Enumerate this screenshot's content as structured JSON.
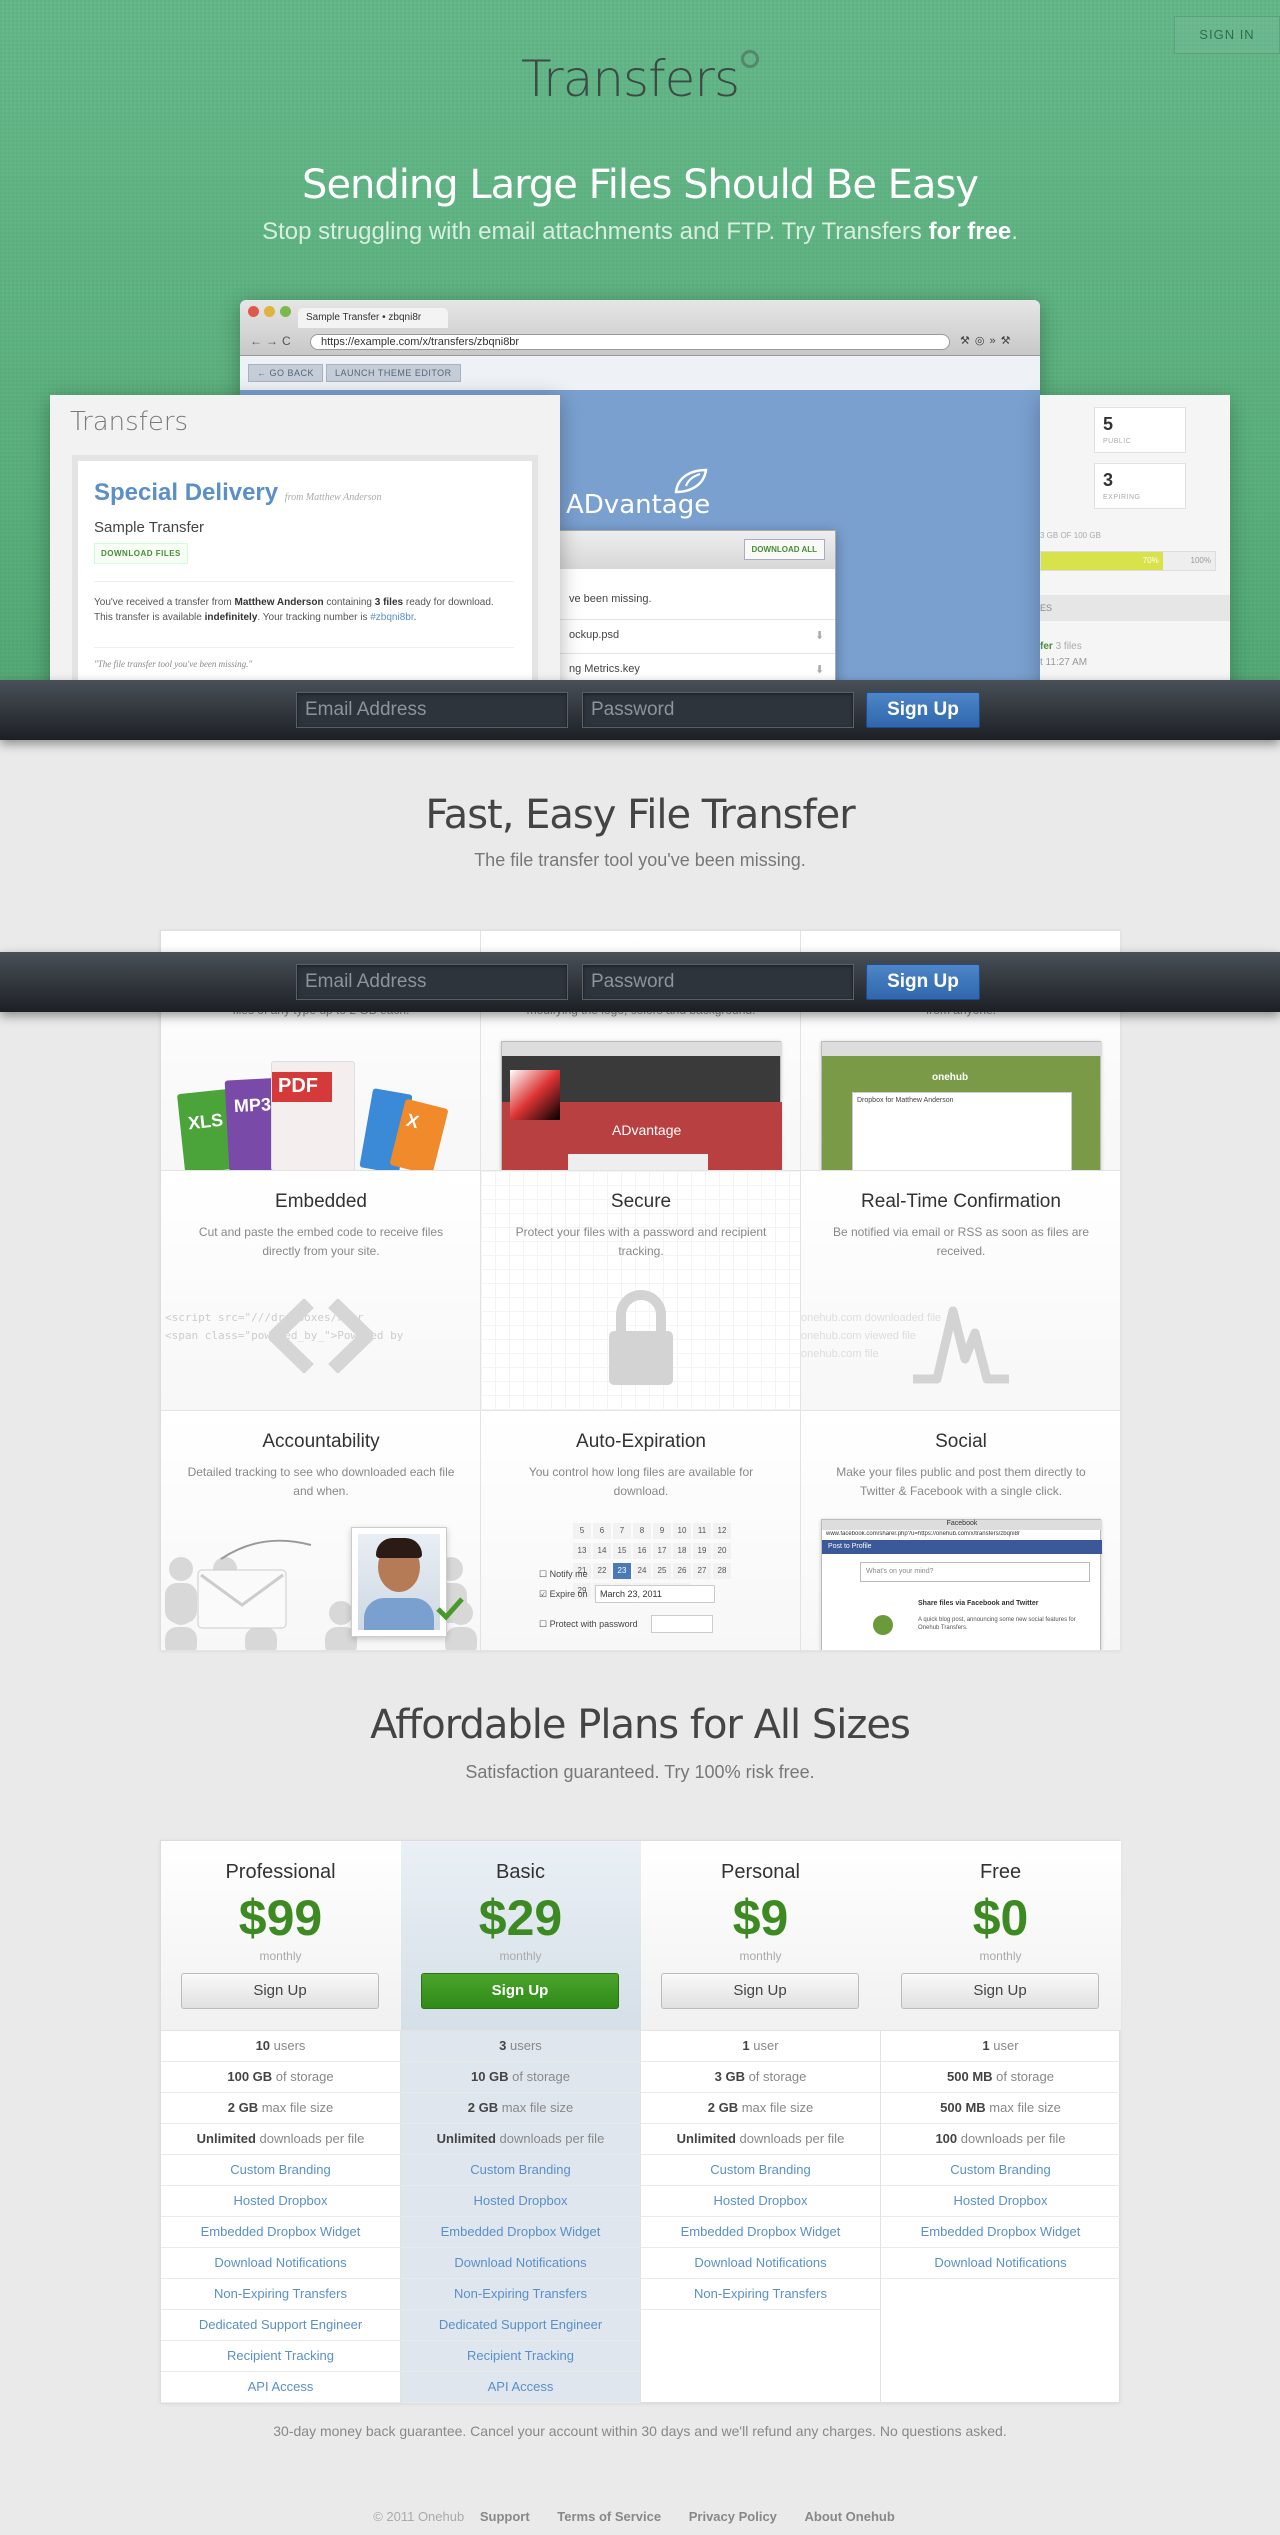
{
  "header": {
    "sign_in": "SIGN IN",
    "logo": "Transfers",
    "headline": "Sending Large Files Should Be Easy",
    "subheadline_prefix": "Stop struggling with email attachments and FTP. Try Transfers ",
    "subheadline_bold": "for free",
    "subheadline_suffix": "."
  },
  "browser": {
    "tab_title": "Sample Transfer • zbqni8r",
    "url": "https://example.com/x/transfers/zbqni8br",
    "go_back": "← GO BACK",
    "launch_theme_editor": "LAUNCH THEME EDITOR",
    "brand_text": "ADvantage"
  },
  "transfer_card": {
    "logo": "Transfers",
    "title": "Special Delivery",
    "from": "from Matthew Anderson",
    "name": "Sample Transfer",
    "download_files": "DOWNLOAD FILES",
    "message_1": "You've received a transfer from ",
    "sender": "Matthew Anderson",
    "message_2": " containing ",
    "file_count": "3 files",
    "message_3": " ready for download.",
    "message_4": "This transfer is available ",
    "availability": "indefinitely",
    "message_5": ". Your tracking number is ",
    "tracking": "#zbqni8br",
    "message_6": ".",
    "tagline": "\"The file transfer tool you've been missing.\""
  },
  "file_panel": {
    "download_all": "DOWNLOAD ALL",
    "intro": "ve been missing.",
    "files": [
      "ockup.psd",
      "ng Metrics.key"
    ]
  },
  "stats_panel": {
    "stats": [
      {
        "value": "5",
        "label": "PUBLIC"
      },
      {
        "value": "3",
        "label": "EXPIRING"
      }
    ],
    "storage_text": "3 GB OF 100 GB",
    "storage_percent": 70,
    "storage_percent_label": "70%",
    "storage_max_label": "100%",
    "section_label": "ES",
    "recent_link": "fer",
    "recent_files": "3 files",
    "recent_time": "t 11:27 AM"
  },
  "signup_bar": {
    "email_placeholder": "Email Address",
    "password_placeholder": "Password",
    "sign_up": "Sign Up"
  },
  "features_section": {
    "title": "Fast, Easy File Transfer",
    "subtitle": "The file transfer tool you've been missing.",
    "row1_partial": [
      "files of any type up to 2 GB each.",
      "modifying the logo, colors and background.",
      "from anyone."
    ],
    "features": [
      {
        "title": "Embedded",
        "description": "Cut and paste the embed code to receive files directly from your site."
      },
      {
        "title": "Secure",
        "description": "Protect your files with a password and recipient tracking."
      },
      {
        "title": "Real-Time Confirmation",
        "description": "Be notified via email or RSS as soon as files are received."
      },
      {
        "title": "Accountability",
        "description": "Detailed tracking to see who downloaded each file and when."
      },
      {
        "title": "Auto-Expiration",
        "description": "You control how long files are available for download."
      },
      {
        "title": "Social",
        "description": "Make your files public and post them directly to Twitter & Facebook with a single click."
      }
    ],
    "file_badges": [
      "XLS",
      "MP3",
      "PDF",
      "X"
    ],
    "embed_code_1": "<script src=\"//",
    "embed_code_2": "/dropboxes/k9nr",
    "embed_code_3": "<span class=\"powered_by_",
    "embed_code_4": "\">Powered by",
    "expire_notify": "Notify me",
    "expire_on": "Expire on",
    "expire_date": "March 23, 2011",
    "protect_label": "Protect with password",
    "facebook_label": "Facebook",
    "facebook_url": "www.facebook.com/sharer.php?u=https://onehub.com/x/transfers/zbqni8r",
    "facebook_post": "Post to Profile",
    "facebook_prompt": "What's on your mind?",
    "facebook_share_title": "Share files via Facebook and Twitter",
    "facebook_share_sub": "A quick blog post, announcing some new social features for Onehub Transfers.",
    "theme_brand": "ADvantage",
    "onehub_brand": "onehub",
    "onehub_dropbox": "Dropbox for Matthew Anderson",
    "rtc_stream_1": "onehub.com downloaded file",
    "rtc_stream_2": "onehub.com viewed file",
    "rtc_stream_3": "onehub.com file"
  },
  "pricing": {
    "title": "Affordable Plans for All Sizes",
    "subtitle": "Satisfaction guaranteed. Try 100% risk free.",
    "plans": [
      {
        "name": "Professional",
        "price": "$99",
        "period": "monthly",
        "button": "Sign Up",
        "highlight": false,
        "users_num": "10",
        "users_label": " users",
        "storage_num": "100 GB",
        "storage_label": " of storage",
        "filesize_num": "2 GB",
        "filesize_label": " max file size",
        "downloads_num": "Unlimited",
        "downloads_label": " downloads per file",
        "features": [
          "Custom Branding",
          "Hosted Dropbox",
          "Embedded Dropbox Widget",
          "Download Notifications",
          "Non-Expiring Transfers",
          "Dedicated Support Engineer",
          "Recipient Tracking",
          "API Access"
        ]
      },
      {
        "name": "Basic",
        "price": "$29",
        "period": "monthly",
        "button": "Sign Up",
        "highlight": true,
        "users_num": "3",
        "users_label": " users",
        "storage_num": "10 GB",
        "storage_label": " of storage",
        "filesize_num": "2 GB",
        "filesize_label": " max file size",
        "downloads_num": "Unlimited",
        "downloads_label": " downloads per file",
        "features": [
          "Custom Branding",
          "Hosted Dropbox",
          "Embedded Dropbox Widget",
          "Download Notifications",
          "Non-Expiring Transfers",
          "Dedicated Support Engineer",
          "Recipient Tracking",
          "API Access"
        ]
      },
      {
        "name": "Personal",
        "price": "$9",
        "period": "monthly",
        "button": "Sign Up",
        "highlight": false,
        "users_num": "1",
        "users_label": " user",
        "storage_num": "3 GB",
        "storage_label": " of storage",
        "filesize_num": "2 GB",
        "filesize_label": " max file size",
        "downloads_num": "Unlimited",
        "downloads_label": " downloads per file",
        "features": [
          "Custom Branding",
          "Hosted Dropbox",
          "Embedded Dropbox Widget",
          "Download Notifications",
          "Non-Expiring Transfers"
        ]
      },
      {
        "name": "Free",
        "price": "$0",
        "period": "monthly",
        "button": "Sign Up",
        "highlight": false,
        "users_num": "1",
        "users_label": " user",
        "storage_num": "500 MB",
        "storage_label": " of storage",
        "filesize_num": "500 MB",
        "filesize_label": " max file size",
        "downloads_num": "100",
        "downloads_label": " downloads per file",
        "features": [
          "Custom Branding",
          "Hosted Dropbox",
          "Embedded Dropbox Widget",
          "Download Notifications"
        ]
      }
    ],
    "guarantee": "30-day money back guarantee. Cancel your account within 30 days and we'll refund any charges. No questions asked."
  },
  "footer": {
    "copyright": "© 2011 Onehub",
    "links": [
      "Support",
      "Terms of Service",
      "Privacy Policy",
      "About Onehub"
    ]
  },
  "colors": {
    "hero_green": "#5ab07c",
    "price_green": "#3d8a22",
    "link_blue": "#5a8fc8",
    "signup_blue": "#3a74bd",
    "highlight_column": "#dfe6ee"
  }
}
